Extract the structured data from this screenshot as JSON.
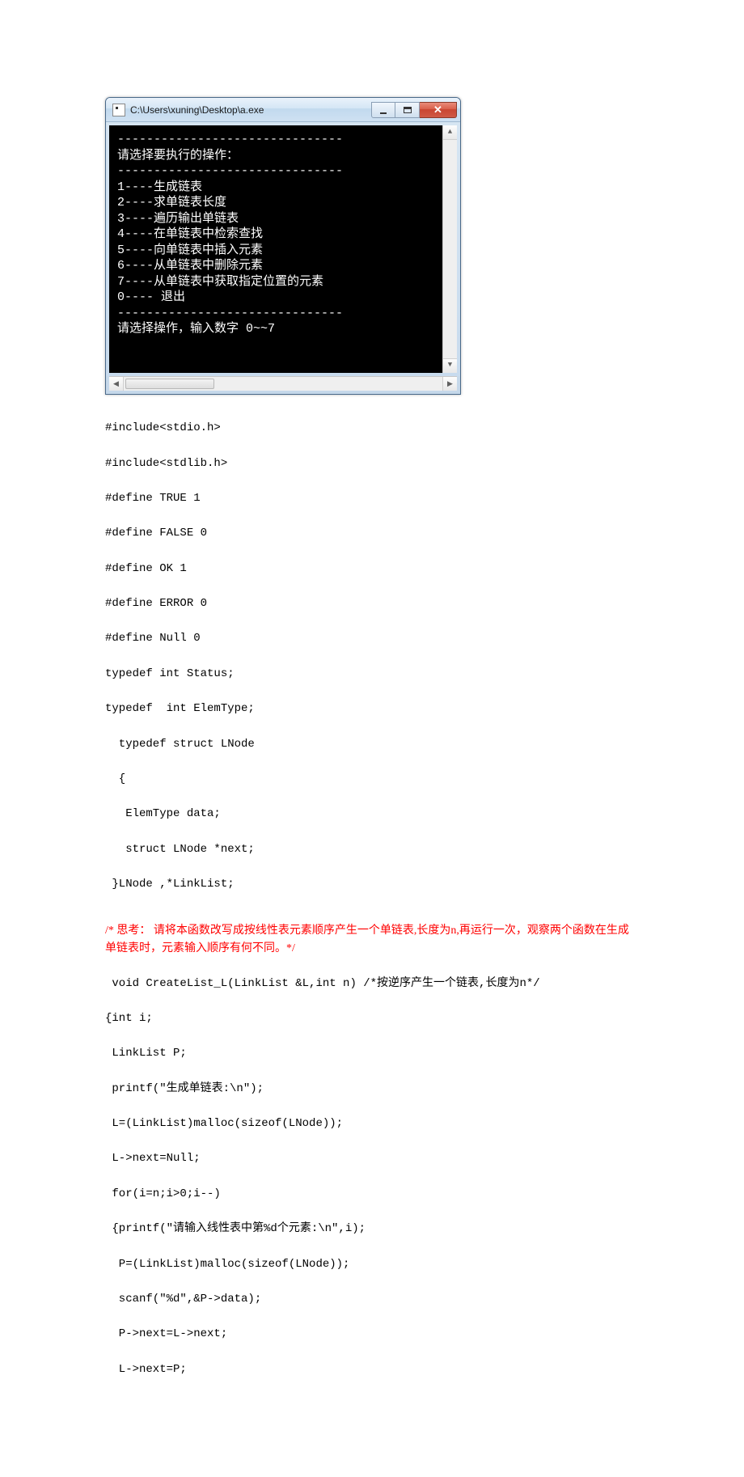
{
  "window": {
    "title": "C:\\Users\\xuning\\Desktop\\a.exe"
  },
  "console": {
    "divider": "-------------------------------",
    "heading": "  请选择要执行的操作：",
    "menu": [
      "  1----生成链表",
      "  2----求单链表长度",
      "  3----遍历输出单链表",
      "  4----在单链表中检索查找",
      "  5----向单链表中插入元素",
      "  6----从单链表中删除元素",
      "  7----从单链表中获取指定位置的元素",
      "  0---- 退出"
    ],
    "prompt": "请选择操作，输入数字 0~~7"
  },
  "code": {
    "block1": [
      "#include<stdio.h>",
      "#include<stdlib.h>",
      "#define TRUE 1",
      "#define FALSE 0",
      "#define OK 1",
      "#define ERROR 0",
      "#define Null 0",
      "typedef int Status;",
      "typedef  int ElemType;",
      "  typedef struct LNode",
      "  {",
      "   ElemType data;",
      "   struct LNode *next;",
      " }LNode ,*LinkList;"
    ],
    "comment_red": "/* 思考：  请将本函数改写成按线性表元素顺序产生一个单链表,长度为n,再运行一次，观察两个函数在生成单链表时，元素输入顺序有何不同。*/",
    "block2": [
      " void CreateList_L(LinkList &L,int n) /*按逆序产生一个链表,长度为n*/",
      "{int i;",
      " LinkList P;",
      " printf(\"生成单链表:\\n\");",
      " L=(LinkList)malloc(sizeof(LNode));",
      " L->next=Null;",
      " for(i=n;i>0;i--)",
      " {printf(\"请输入线性表中第%d个元素:\\n\",i);",
      "  P=(LinkList)malloc(sizeof(LNode));",
      "  scanf(\"%d\",&P->data);",
      "  P->next=L->next;",
      "  L->next=P;"
    ]
  }
}
